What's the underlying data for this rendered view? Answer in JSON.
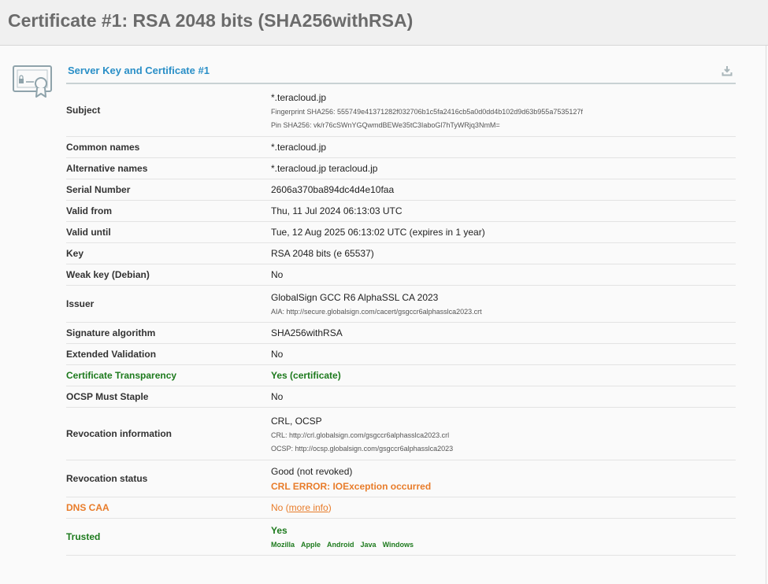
{
  "page": {
    "title": "Certificate #1: RSA 2048 bits (SHA256withRSA)"
  },
  "section": {
    "title": "Server Key and Certificate #1",
    "download_icon": "download-icon",
    "cert_icon": "certificate-icon"
  },
  "colors": {
    "link_blue": "#2a8fc7",
    "ok_green": "#1d7a1d",
    "warn_orange": "#e87c2a",
    "title_gray": "#6b6b6b"
  },
  "rows": {
    "subject": {
      "label": "Subject",
      "value": "*.teracloud.jp",
      "fingerprint": "Fingerprint SHA256: 555749e41371282f032706b1c5fa2416cb5a0d0dd4b102d9d63b955a7535127f",
      "pin": "Pin SHA256: vk/r76cSWnYGQwmdBEWe35tC3IaboGl7hTyWRjq3NmM="
    },
    "common_names": {
      "label": "Common names",
      "value": "*.teracloud.jp"
    },
    "alt_names": {
      "label": "Alternative names",
      "value": "*.teracloud.jp teracloud.jp"
    },
    "serial": {
      "label": "Serial Number",
      "value": "2606a370ba894dc4d4e10faa"
    },
    "valid_from": {
      "label": "Valid from",
      "value": "Thu, 11 Jul 2024 06:13:03 UTC"
    },
    "valid_until": {
      "label": "Valid until",
      "value": "Tue, 12 Aug 2025 06:13:02 UTC (expires in 1 year)"
    },
    "key": {
      "label": "Key",
      "value": "RSA 2048 bits (e 65537)"
    },
    "weak_key": {
      "label": "Weak key (Debian)",
      "value": "No"
    },
    "issuer": {
      "label": "Issuer",
      "value": "GlobalSign GCC R6 AlphaSSL CA 2023",
      "aia": "AIA: http://secure.globalsign.com/cacert/gsgccr6alphasslca2023.crt"
    },
    "sig_alg": {
      "label": "Signature algorithm",
      "value": "SHA256withRSA"
    },
    "ev": {
      "label": "Extended Validation",
      "value": "No"
    },
    "ct": {
      "label": "Certificate Transparency",
      "value": "Yes (certificate)"
    },
    "ocsp_staple": {
      "label": "OCSP Must Staple",
      "value": "No"
    },
    "revocation_info": {
      "label": "Revocation information",
      "value": "CRL, OCSP",
      "crl": "CRL: http://crl.globalsign.com/gsgccr6alphasslca2023.crl",
      "ocsp": "OCSP: http://ocsp.globalsign.com/gsgccr6alphasslca2023"
    },
    "revocation_status": {
      "label": "Revocation status",
      "value": "Good (not revoked)",
      "error": "CRL ERROR: IOException occurred"
    },
    "dns_caa": {
      "label": "DNS CAA",
      "value_prefix": "No (",
      "link": "more info",
      "value_suffix": ")"
    },
    "trusted": {
      "label": "Trusted",
      "value": "Yes",
      "stores": [
        "Mozilla",
        "Apple",
        "Android",
        "Java",
        "Windows"
      ]
    }
  }
}
